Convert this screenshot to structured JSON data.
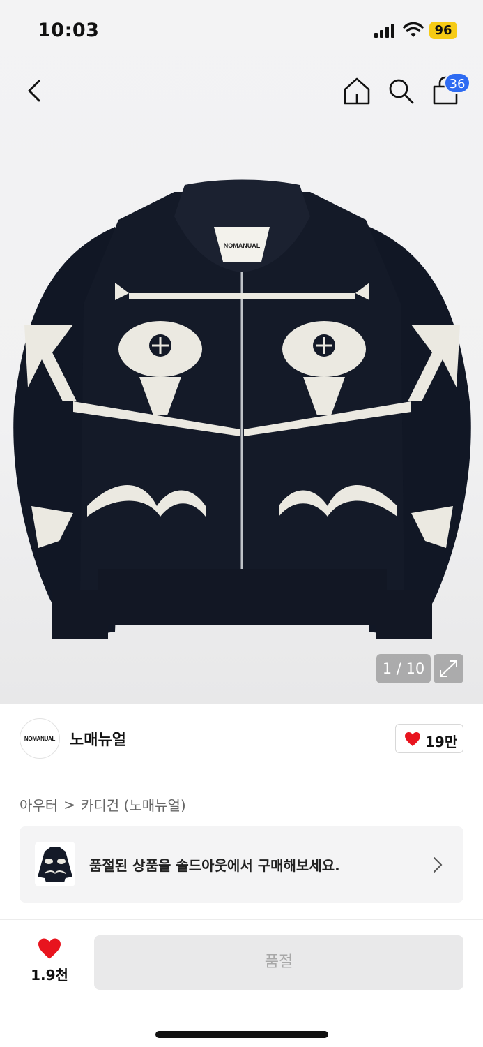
{
  "status_bar": {
    "time": "10:03",
    "battery": "96",
    "battery_color": "#f6cb15"
  },
  "nav": {
    "cart_count": "36",
    "back_icon": "chevron-left-icon",
    "home_icon": "home-icon",
    "search_icon": "search-icon",
    "bag_icon": "shopping-bag-icon",
    "badge_color": "#2e6bf2"
  },
  "gallery": {
    "counter": "1 / 10",
    "expand_icon": "expand-icon",
    "sweater_label": "NOMANUAL"
  },
  "brand": {
    "logo_text": "NOMANUAL",
    "name": "노매뉴얼",
    "likes": "19만",
    "heart_color": "#e8141e"
  },
  "breadcrumb": {
    "category": "아우터",
    "separator": ">",
    "subcategory": "카디건 (노매뉴얼)"
  },
  "soldout_banner": {
    "text": "품절된 상품을 솔드아웃에서 구매해보세요.",
    "chevron_icon": "chevron-right-icon"
  },
  "bottom_bar": {
    "wish_count": "1.9천",
    "button_label": "품절"
  }
}
